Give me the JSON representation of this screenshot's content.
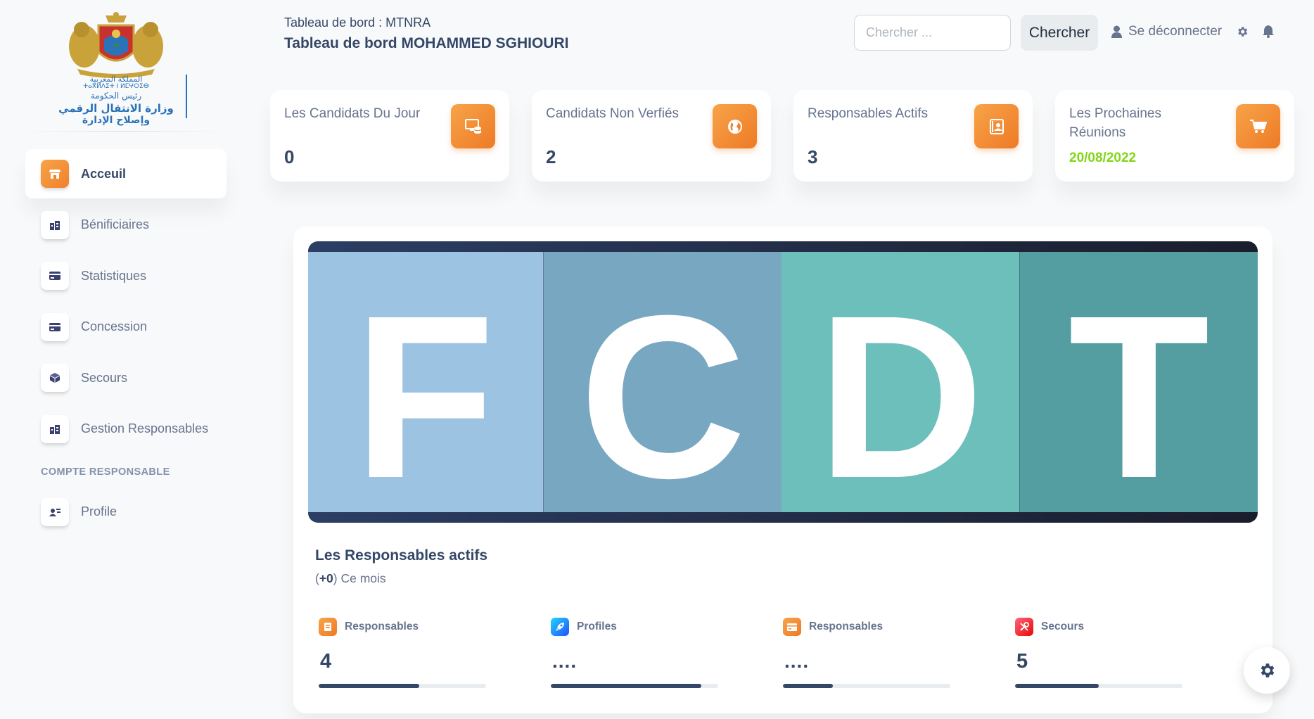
{
  "sidebar": {
    "logo": {
      "line1": "المملكة المغربية",
      "line2": "ⵜⴰⴳⵍⴷⵉⵜ ⵏ ⵍⵎⵖⵔⵉⴱ",
      "line3": "رئيس الحكومة",
      "line4": "وزارة الانتقال الرقمي",
      "line5": "وإصلاح الإدارة"
    },
    "items": [
      {
        "label": "Acceuil",
        "icon": "shop-icon",
        "active": true
      },
      {
        "label": "Bénificiaires",
        "icon": "office-icon"
      },
      {
        "label": "Statistiques",
        "icon": "credit-card-icon"
      },
      {
        "label": "Concession",
        "icon": "credit-card-icon"
      },
      {
        "label": "Secours",
        "icon": "box-icon"
      },
      {
        "label": "Gestion Responsables",
        "icon": "office-icon"
      }
    ],
    "section_title": "COMPTE RESPONSABLE",
    "account_items": [
      {
        "label": "Profile",
        "icon": "user-card-icon"
      }
    ]
  },
  "header": {
    "breadcrumb": "Tableau de bord : MTNRA",
    "title": "Tableau de bord MOHAMMED SGHIOURI",
    "search_placeholder": "Chercher ...",
    "search_button": "Chercher",
    "logout_label": "Se déconnecter"
  },
  "stats": [
    {
      "title": "Les Candidats Du Jour",
      "value": "0",
      "icon": "screen-icon"
    },
    {
      "title": "Candidats Non Verfiés",
      "value": "2",
      "icon": "world-icon"
    },
    {
      "title": "Responsables Actifs",
      "value": "3",
      "icon": "paper-icon"
    },
    {
      "title": "Les Prochaines Réunions",
      "value": "20/08/2022",
      "icon": "cart-icon",
      "value_color": "#82d616"
    }
  ],
  "banner": {
    "letters": [
      "F",
      "C",
      "D",
      "T"
    ],
    "colors": [
      "#9cc3e2",
      "#78a7c2",
      "#6dbfbc",
      "#549ea1"
    ]
  },
  "active_responsables": {
    "title": "Les Responsables actifs",
    "meta_prefix": "(",
    "meta_strong": "+0",
    "meta_suffix": ") Ce mois",
    "metrics": [
      {
        "label": "Responsables",
        "value": "4",
        "progress": 0.6,
        "icon": "document-icon",
        "color": "#f0812b"
      },
      {
        "label": "Profiles",
        "value": "....",
        "progress": 0.9,
        "icon": "rocket-icon",
        "color": "#2f80ed"
      },
      {
        "label": "Responsables",
        "value": "....",
        "progress": 0.3,
        "icon": "card-icon",
        "color": "#f0812b"
      },
      {
        "label": "Secours",
        "value": "5",
        "progress": 0.5,
        "icon": "tools-icon",
        "color": "#ea0606"
      }
    ]
  }
}
